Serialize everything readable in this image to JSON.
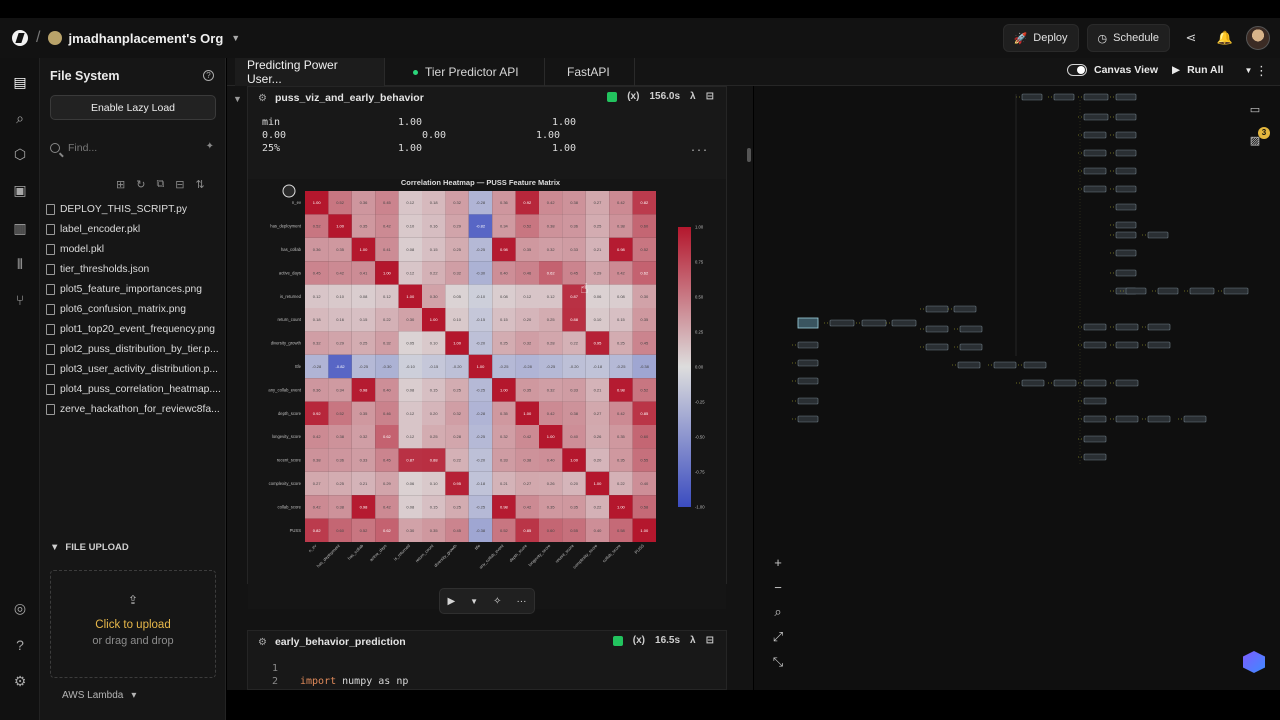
{
  "header": {
    "org_name": "jmadhanplacement's Org",
    "deploy": "Deploy",
    "schedule": "Schedule"
  },
  "sidebar": {
    "title": "File System",
    "lazy_load": "Enable Lazy Load",
    "find_placeholder": "Find...",
    "files": [
      "DEPLOY_THIS_SCRIPT.py",
      "label_encoder.pkl",
      "model.pkl",
      "tier_thresholds.json",
      "plot5_feature_importances.png",
      "plot6_confusion_matrix.png",
      "plot1_top20_event_frequency.png",
      "plot2_puss_distribution_by_tier.p...",
      "plot3_user_activity_distribution.p...",
      "plot4_puss_correlation_heatmap....",
      "zerve_hackathon_for_reviewc8fa..."
    ],
    "upload_title": "FILE UPLOAD",
    "upload_main": "Click to upload",
    "upload_sub": "or drag and drop",
    "footer": "AWS Lambda"
  },
  "tabs": [
    {
      "label": "Predicting Power User..."
    },
    {
      "label": "Tier Predictor API"
    },
    {
      "label": "FastAPI"
    }
  ],
  "toolbar": {
    "canvas_view": "Canvas View",
    "run_all": "Run All"
  },
  "cell1": {
    "name": "puss_viz_and_early_behavior",
    "var_label": "(x)",
    "time": "156.0s",
    "lambda": "λ",
    "stats_rows": [
      [
        "min",
        "1.00",
        "",
        "1.00"
      ],
      [
        "0.00",
        "",
        "0.00",
        "1.00"
      ],
      [
        "25%",
        "1.00",
        "",
        "1.00"
      ]
    ],
    "ellipsis": "..."
  },
  "cell2": {
    "name": "early_behavior_prediction",
    "var_label": "(x)",
    "time": "16.5s",
    "lambda": "λ",
    "code": [
      {
        "n": "1",
        "text": ""
      },
      {
        "n": "2",
        "kw": "import",
        "text": " numpy as np"
      }
    ]
  },
  "canvas": {
    "badge": "3"
  },
  "colors": {
    "accent_upload": "#e8b84a",
    "status_green": "#22c35e",
    "heat_high": "#b4172d",
    "heat_low": "#3b4cc0"
  },
  "chart_data": {
    "type": "heatmap",
    "title": "Correlation Heatmap — PUSS Feature Matrix",
    "labels": [
      "n_ev",
      "has_deployment",
      "has_collab",
      "active_days",
      "is_returned",
      "return_count",
      "diversity_growth",
      "ttfe",
      "any_collab_event",
      "depth_score",
      "longevity_score",
      "recent_score",
      "complexity_score",
      "collab_score",
      "PUSS"
    ],
    "values": [
      [
        1.0,
        0.52,
        0.36,
        0.45,
        0.12,
        0.18,
        0.32,
        -0.28,
        0.36,
        0.92,
        0.42,
        0.38,
        0.27,
        0.42,
        0.82
      ],
      [
        0.52,
        1.0,
        0.35,
        0.42,
        0.1,
        0.16,
        0.29,
        -0.82,
        0.34,
        0.52,
        0.38,
        0.36,
        0.25,
        0.38,
        0.6
      ],
      [
        0.36,
        0.35,
        1.0,
        0.41,
        0.08,
        0.15,
        0.25,
        -0.25,
        0.98,
        0.35,
        0.32,
        0.33,
        0.21,
        0.98,
        0.52
      ],
      [
        0.45,
        0.42,
        0.41,
        1.0,
        0.12,
        0.22,
        0.32,
        -0.3,
        0.4,
        0.46,
        0.62,
        0.45,
        0.29,
        0.42,
        0.62
      ],
      [
        0.12,
        0.1,
        0.08,
        0.12,
        1.0,
        0.3,
        0.05,
        -0.1,
        0.08,
        0.12,
        0.12,
        0.87,
        0.06,
        0.08,
        0.3
      ],
      [
        0.18,
        0.16,
        0.15,
        0.22,
        0.3,
        1.0,
        0.1,
        -0.15,
        0.15,
        0.2,
        0.25,
        0.88,
        0.1,
        0.15,
        0.35
      ],
      [
        0.32,
        0.29,
        0.25,
        0.32,
        0.05,
        0.1,
        1.0,
        -0.2,
        0.25,
        0.32,
        0.28,
        0.22,
        0.95,
        0.25,
        0.45
      ],
      [
        -0.28,
        -0.82,
        -0.25,
        -0.3,
        -0.1,
        -0.15,
        -0.2,
        1.0,
        -0.25,
        -0.28,
        -0.25,
        -0.2,
        -0.18,
        -0.25,
        -0.38
      ],
      [
        0.36,
        0.34,
        0.98,
        0.4,
        0.08,
        0.15,
        0.25,
        -0.25,
        1.0,
        0.35,
        0.32,
        0.33,
        0.21,
        0.98,
        0.52
      ],
      [
        0.92,
        0.52,
        0.35,
        0.46,
        0.12,
        0.2,
        0.32,
        -0.28,
        0.35,
        1.0,
        0.42,
        0.38,
        0.27,
        0.42,
        0.85
      ],
      [
        0.42,
        0.38,
        0.32,
        0.62,
        0.12,
        0.25,
        0.28,
        -0.25,
        0.32,
        0.42,
        1.0,
        0.4,
        0.26,
        0.35,
        0.6
      ],
      [
        0.38,
        0.36,
        0.33,
        0.45,
        0.87,
        0.88,
        0.22,
        -0.2,
        0.33,
        0.38,
        0.4,
        1.0,
        0.2,
        0.35,
        0.55
      ],
      [
        0.27,
        0.25,
        0.21,
        0.29,
        0.06,
        0.1,
        0.95,
        -0.18,
        0.21,
        0.27,
        0.26,
        0.2,
        1.0,
        0.22,
        0.4
      ],
      [
        0.42,
        0.38,
        0.98,
        0.42,
        0.08,
        0.15,
        0.25,
        -0.25,
        0.98,
        0.42,
        0.35,
        0.35,
        0.22,
        1.0,
        0.58
      ],
      [
        0.82,
        0.6,
        0.52,
        0.62,
        0.3,
        0.35,
        0.45,
        -0.38,
        0.52,
        0.85,
        0.6,
        0.55,
        0.4,
        0.58,
        1.0
      ]
    ],
    "colorbar_ticks": [
      "1.00",
      "0.75",
      "0.50",
      "0.25",
      "0.00",
      "-0.25",
      "-0.50",
      "-0.75",
      "-1.00"
    ],
    "vmin": -1,
    "vmax": 1
  }
}
